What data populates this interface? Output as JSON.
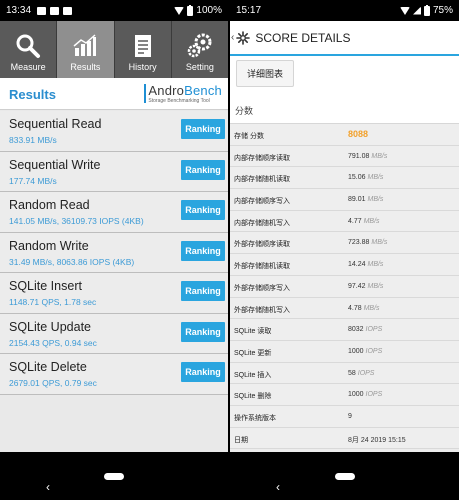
{
  "left": {
    "status": {
      "time": "13:34",
      "battery": "100%"
    },
    "tabs": [
      {
        "label": "Measure",
        "icon": "search-icon"
      },
      {
        "label": "Results",
        "icon": "bar-chart-icon"
      },
      {
        "label": "History",
        "icon": "document-icon"
      },
      {
        "label": "Setting",
        "icon": "gears-icon"
      }
    ],
    "results_title": "Results",
    "logo": {
      "andro": "Andro",
      "bench": "Bench",
      "sub": "Storage Benchmarking Tool"
    },
    "ranking_label": "Ranking",
    "results": [
      {
        "name": "Sequential Read",
        "value": "833.91 MB/s"
      },
      {
        "name": "Sequential Write",
        "value": "177.74 MB/s"
      },
      {
        "name": "Random Read",
        "value": "141.05 MB/s, 36109.73 IOPS (4KB)"
      },
      {
        "name": "Random Write",
        "value": "31.49 MB/s, 8063.86 IOPS (4KB)"
      },
      {
        "name": "SQLite Insert",
        "value": "1148.71 QPS, 1.78 sec"
      },
      {
        "name": "SQLite Update",
        "value": "2154.43 QPS, 0.94 sec"
      },
      {
        "name": "SQLite Delete",
        "value": "2679.01 QPS, 0.79 sec"
      }
    ]
  },
  "right": {
    "status": {
      "time": "15:17",
      "battery": "75%"
    },
    "title": "SCORE DETAILS",
    "chart_button": "详细图表",
    "score_label": "分数",
    "rows": [
      {
        "key": "存储 分数",
        "value": "8088",
        "unit": ""
      },
      {
        "key": "内部存储顺序读取",
        "value": "791.08",
        "unit": "MB/s"
      },
      {
        "key": "内部存储随机读取",
        "value": "15.06",
        "unit": "MB/s"
      },
      {
        "key": "内部存储顺序写入",
        "value": "89.01",
        "unit": "MB/s"
      },
      {
        "key": "内部存储随机写入",
        "value": "4.77",
        "unit": "MB/s"
      },
      {
        "key": "外部存储顺序读取",
        "value": "723.88",
        "unit": "MB/s"
      },
      {
        "key": "外部存储随机读取",
        "value": "14.24",
        "unit": "MB/s"
      },
      {
        "key": "外部存储顺序写入",
        "value": "97.42",
        "unit": "MB/s"
      },
      {
        "key": "外部存储随机写入",
        "value": "4.78",
        "unit": "MB/s"
      },
      {
        "key": "SQLite 读取",
        "value": "8032",
        "unit": "IOPS"
      },
      {
        "key": "SQLite 更新",
        "value": "1000",
        "unit": "IOPS"
      },
      {
        "key": "SQLite 插入",
        "value": "58",
        "unit": "IOPS"
      },
      {
        "key": "SQLite 删除",
        "value": "1000",
        "unit": "IOPS"
      },
      {
        "key": "操作系统版本",
        "value": "9",
        "unit": ""
      },
      {
        "key": "日期",
        "value": "8月 24 2019 15:15",
        "unit": ""
      }
    ]
  },
  "colors": {
    "accent": "#2aa5df",
    "score": "#f2a12b",
    "tab_bg": "#5a5a5a",
    "tab_active": "#8f8f8f"
  }
}
